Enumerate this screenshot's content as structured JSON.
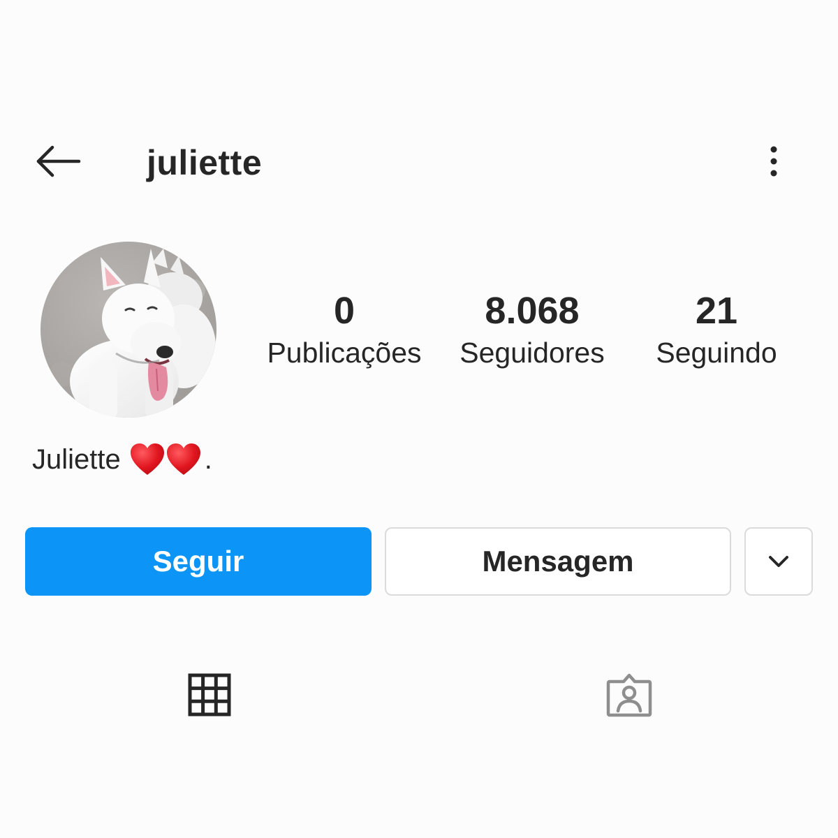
{
  "header": {
    "username": "juliette",
    "back_icon": "arrow-left-icon",
    "more_icon": "more-vertical-icon"
  },
  "profile": {
    "avatar_icon": "white-bull-terrier-dog-photo",
    "stats": [
      {
        "value": "0",
        "label": "Publicações"
      },
      {
        "value": "8.068",
        "label": "Seguidores"
      },
      {
        "value": "21",
        "label": "Seguindo"
      }
    ],
    "bio": {
      "name": "Juliette",
      "hearts_icon": "red-heart-emoji",
      "suffix": "."
    }
  },
  "actions": {
    "follow_label": "Seguir",
    "message_label": "Mensagem",
    "dropdown_icon": "chevron-down-icon"
  },
  "tabs": {
    "grid_icon": "grid-icon",
    "tagged_icon": "tagged-person-icon"
  },
  "colors": {
    "primary_blue": "#0c95f6",
    "text": "#262626",
    "border": "#dbdbdb",
    "background": "#fcfcfc",
    "heart_red": "#e0151e",
    "tab_inactive": "#8e8e8e"
  }
}
